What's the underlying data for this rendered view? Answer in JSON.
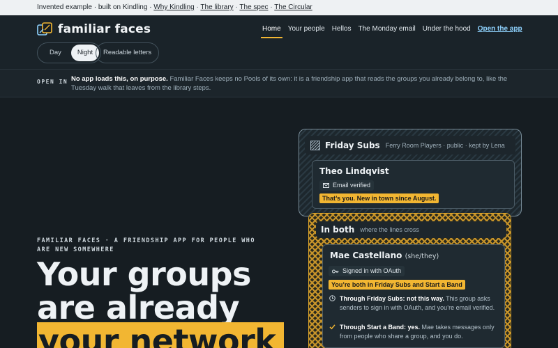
{
  "topstrip": {
    "prefix": "Invented example · built on Kindling ·",
    "links": [
      "Why Kindling",
      "The library",
      "The spec",
      "The Circular"
    ]
  },
  "header": {
    "logo_text": "familiar faces",
    "nav": [
      "Home",
      "Your people",
      "Hellos",
      "The Monday email",
      "Under the hood"
    ],
    "cta": "Open the app",
    "modes": [
      "Day",
      "Night"
    ],
    "readable": "Readable letters"
  },
  "banner": {
    "label": "OPEN IN",
    "lead": "No app loads this, on purpose.",
    "text": " Familiar Faces keeps no Pools of its own: it is a friendship app that reads the groups you already belong to, like the Tuesday walk that leaves from the library steps."
  },
  "hero": {
    "eyebrow": "FAMILIAR FACES · A FRIENDSHIP APP FOR PEOPLE WHO ARE NEW SOMEWHERE",
    "line1": "Your groups",
    "line2": "are already",
    "line3": "your network"
  },
  "group_card": {
    "title": "Friday Subs",
    "meta": "Ferry Room Players · public · kept by Lena",
    "person": {
      "name": "Theo Lindqvist",
      "badge": "Email verified",
      "note": "That’s you. New in town since August."
    }
  },
  "both_card": {
    "title": "In both",
    "meta": "where the lines cross",
    "person": {
      "name": "Mae Castellano",
      "pronouns": "(she/they)",
      "badge": "Signed in with OAuth",
      "tag": "You’re both in Friday Subs and Start a Band",
      "reasons": [
        {
          "lead": "Through Friday Subs: not this way.",
          "text": " This group asks senders to sign in with OAuth, and you’re email verified."
        },
        {
          "lead": "Through Start a Band: yes.",
          "text": " Mae takes messages only from people who share a group, and you do."
        }
      ]
    }
  },
  "colors": {
    "accent": "#f2b632",
    "link": "#8fd3ff",
    "background": "#161d22"
  }
}
